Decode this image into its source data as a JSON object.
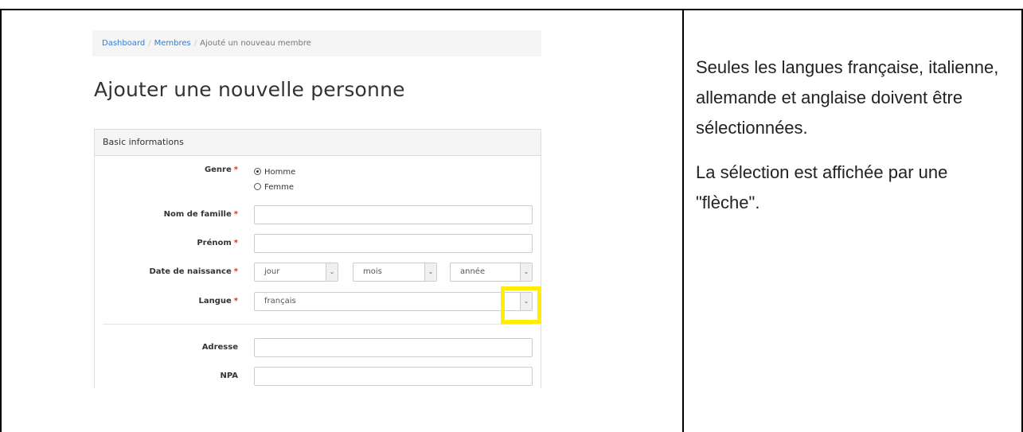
{
  "breadcrumb": {
    "items": [
      "Dashboard",
      "Membres",
      "Ajouté un nouveau membre"
    ]
  },
  "page_title": "Ajouter une nouvelle personne",
  "panel": {
    "heading": "Basic informations"
  },
  "form": {
    "genre": {
      "label": "Genre",
      "required": "*",
      "options": [
        "Homme",
        "Femme"
      ],
      "selected": "Homme"
    },
    "nom": {
      "label": "Nom de famille",
      "required": "*",
      "value": ""
    },
    "prenom": {
      "label": "Prénom",
      "required": "*",
      "value": ""
    },
    "naissance": {
      "label": "Date de naissance",
      "required": "*",
      "jour": "jour",
      "mois": "mois",
      "annee": "année"
    },
    "langue": {
      "label": "Langue",
      "required": "*",
      "value": "français"
    },
    "adresse": {
      "label": "Adresse",
      "value": ""
    },
    "npa": {
      "label": "NPA",
      "value": ""
    }
  },
  "icons": {
    "dropdown": "chevron-down-icon",
    "radio": "radio-icon"
  },
  "colors": {
    "highlight": "#ffee00",
    "link": "#3a7bc8",
    "required": "#c0392b"
  },
  "note": {
    "paragraph1": "Seules les langues française, italienne, allemande et anglaise doivent être sélectionnées.",
    "paragraph2": "La sélection est affichée par une \"flèche\"."
  }
}
